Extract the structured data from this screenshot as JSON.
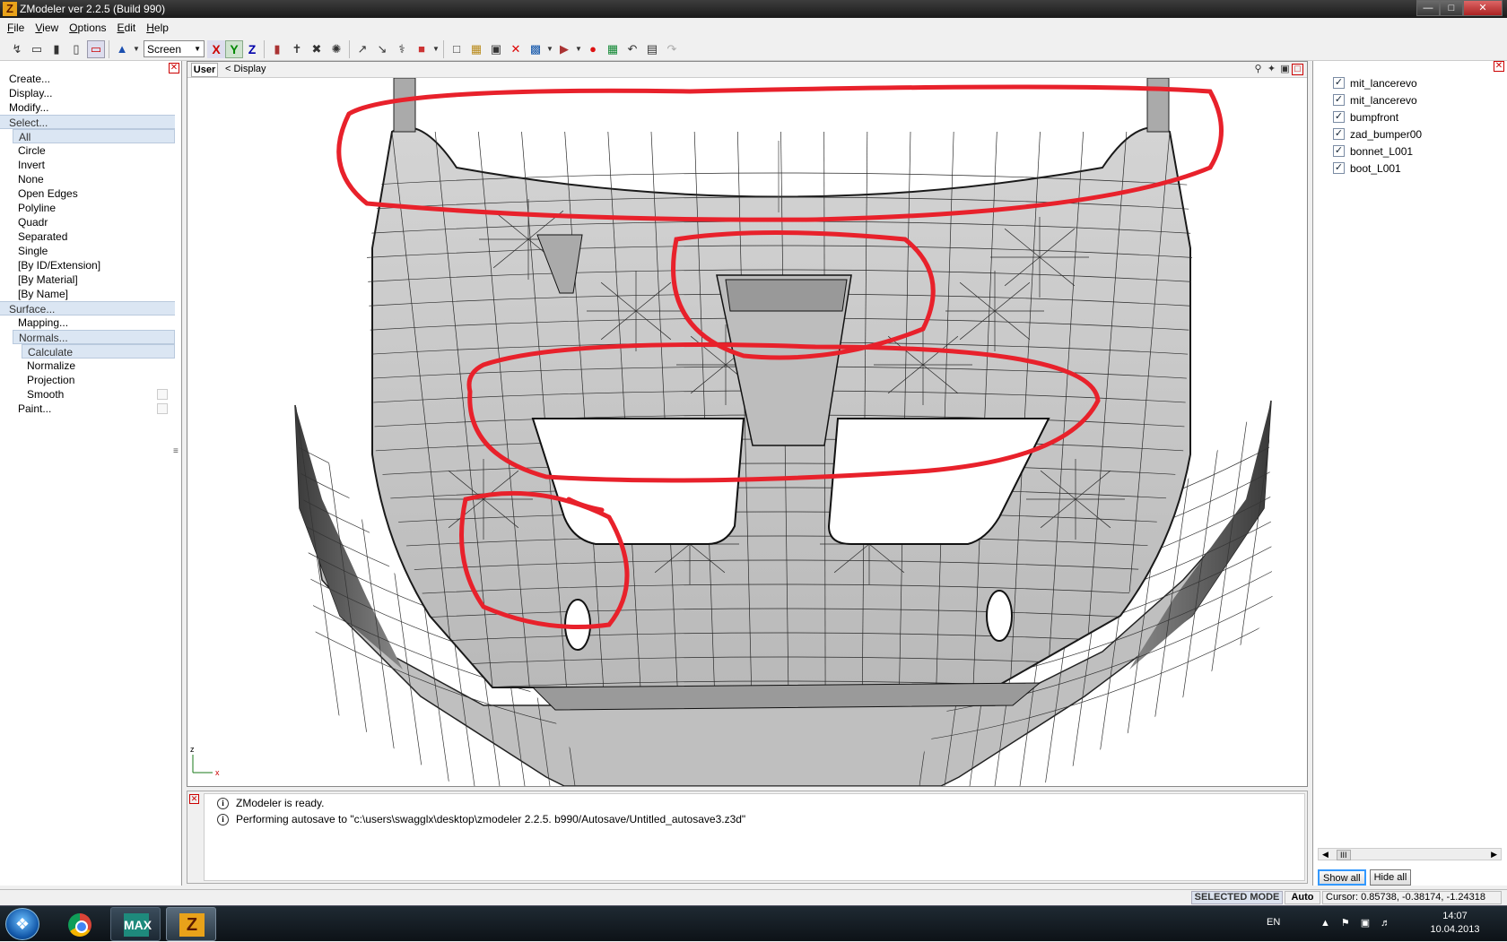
{
  "window": {
    "title": "ZModeler ver 2.2.5 (Build 990)",
    "app_icon": "Z",
    "buttons": [
      "minimize",
      "maximize",
      "close"
    ]
  },
  "menu": [
    {
      "label": "File",
      "accel": "F"
    },
    {
      "label": "View",
      "accel": "V"
    },
    {
      "label": "Options",
      "accel": "O"
    },
    {
      "label": "Edit",
      "accel": "E"
    },
    {
      "label": "Help",
      "accel": "H"
    }
  ],
  "toolbar": {
    "coord_system": "Screen",
    "axes": [
      "X",
      "Y",
      "Z"
    ]
  },
  "left_panel": {
    "items": [
      {
        "label": "Create...",
        "level": 0,
        "selected": false,
        "checkbox": false
      },
      {
        "label": "Display...",
        "level": 0,
        "selected": false,
        "checkbox": false
      },
      {
        "label": "Modify...",
        "level": 0,
        "selected": false,
        "checkbox": false
      },
      {
        "label": "Select...",
        "level": 0,
        "selected": true,
        "checkbox": false
      },
      {
        "label": "All",
        "level": 1,
        "selected": true,
        "checkbox": false
      },
      {
        "label": "Circle",
        "level": 1,
        "selected": false,
        "checkbox": false
      },
      {
        "label": "Invert",
        "level": 1,
        "selected": false,
        "checkbox": false
      },
      {
        "label": "None",
        "level": 1,
        "selected": false,
        "checkbox": false
      },
      {
        "label": "Open Edges",
        "level": 1,
        "selected": false,
        "checkbox": false
      },
      {
        "label": "Polyline",
        "level": 1,
        "selected": false,
        "checkbox": false
      },
      {
        "label": "Quadr",
        "level": 1,
        "selected": false,
        "checkbox": false
      },
      {
        "label": "Separated",
        "level": 1,
        "selected": false,
        "checkbox": false
      },
      {
        "label": "Single",
        "level": 1,
        "selected": false,
        "checkbox": false
      },
      {
        "label": "[By ID/Extension]",
        "level": 1,
        "selected": false,
        "checkbox": false
      },
      {
        "label": "[By Material]",
        "level": 1,
        "selected": false,
        "checkbox": false
      },
      {
        "label": "[By Name]",
        "level": 1,
        "selected": false,
        "checkbox": false
      },
      {
        "label": "Surface...",
        "level": 0,
        "selected": true,
        "checkbox": false
      },
      {
        "label": "Mapping...",
        "level": 1,
        "selected": false,
        "checkbox": false
      },
      {
        "label": "Normals...",
        "level": 1,
        "selected": true,
        "checkbox": false
      },
      {
        "label": "Calculate",
        "level": 2,
        "selected": true,
        "checkbox": false
      },
      {
        "label": "Normalize",
        "level": 2,
        "selected": false,
        "checkbox": false
      },
      {
        "label": "Projection",
        "level": 2,
        "selected": false,
        "checkbox": false
      },
      {
        "label": "Smooth",
        "level": 2,
        "selected": false,
        "checkbox": true
      },
      {
        "label": "Paint...",
        "level": 1,
        "selected": false,
        "checkbox": true
      }
    ]
  },
  "viewport": {
    "view_name": "User",
    "breadcrumb": "<  Display",
    "axis_labels": {
      "z": "z",
      "x": "x"
    }
  },
  "objects": {
    "items": [
      {
        "name": "mit_lancerevo",
        "checked": true
      },
      {
        "name": "mit_lancerevo",
        "checked": true
      },
      {
        "name": "bumpfront",
        "checked": true
      },
      {
        "name": "zad_bumper00",
        "checked": true
      },
      {
        "name": "bonnet_L001",
        "checked": true
      },
      {
        "name": "boot_L001",
        "checked": true
      }
    ],
    "show_all_label": "Show all",
    "hide_all_label": "Hide all",
    "scroll_label": "III"
  },
  "log": {
    "lines": [
      "ZModeler is ready.",
      "Performing autosave to \"c:\\users\\swagglx\\desktop\\zmodeler 2.2.5. b990/Autosave/Untitled_autosave3.z3d\""
    ]
  },
  "status": {
    "mode": "SELECTED MODE",
    "snap": "Auto",
    "cursor": "Cursor: 0.85738, -0.38174, -1.24318"
  },
  "taskbar": {
    "apps": [
      "chrome-icon",
      "3dsmax-icon",
      "zmodeler-icon"
    ],
    "max_label": "MAX",
    "zm_label": "Z",
    "language": "EN",
    "time": "14:07",
    "date": "10.04.2013"
  },
  "colors": {
    "annotation_red": "#e8212b",
    "mesh_fill": "#c8c8c8",
    "mesh_line": "#2b2b2b"
  }
}
